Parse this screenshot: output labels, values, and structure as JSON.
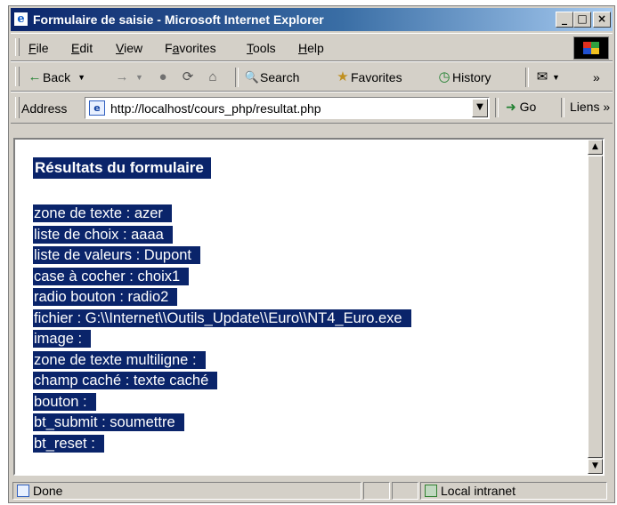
{
  "window": {
    "title": "Formulaire de saisie - Microsoft Internet Explorer",
    "controls": {
      "minimize": "_",
      "maximize": "□",
      "close": "×"
    }
  },
  "menubar": {
    "items": [
      {
        "label": "File",
        "ul": "F",
        "rest": "ile"
      },
      {
        "label": "Edit",
        "ul": "E",
        "rest": "dit"
      },
      {
        "label": "View",
        "ul": "V",
        "rest": "iew"
      },
      {
        "label": "Favorites",
        "pre": "F",
        "ul": "a",
        "rest": "vorites"
      },
      {
        "label": "Tools",
        "ul": "T",
        "rest": "ools"
      },
      {
        "label": "Help",
        "ul": "H",
        "rest": "elp"
      }
    ]
  },
  "toolbar": {
    "back": "Back",
    "search": "Search",
    "favorites": "Favorites",
    "history": "History",
    "icons": {
      "back": "←",
      "forward": "→",
      "stop": "●",
      "refresh": "⟳",
      "home": "⌂",
      "search": "🔍",
      "favorites": "★",
      "history": "◷",
      "mail": "✉",
      "more": "»"
    }
  },
  "address": {
    "label": "Address",
    "url": "http://localhost/cours_php/resultat.php",
    "go": "Go",
    "links": "Liens"
  },
  "page": {
    "heading": "Résultats du formulaire",
    "lines": [
      "zone de texte : azer",
      "liste de choix : aaaa",
      "liste de valeurs : Dupont",
      "case à cocher : choix1",
      "radio bouton : radio2",
      "fichier : G:\\\\Internet\\\\Outils_Update\\\\Euro\\\\NT4_Euro.exe",
      "image :",
      "zone de texte multiligne :",
      "champ caché : texte caché",
      "bouton :",
      "bt_submit : soumettre",
      "bt_reset :"
    ],
    "selection_color": "#0a246a"
  },
  "statusbar": {
    "status": "Done",
    "zone": "Local intranet"
  }
}
